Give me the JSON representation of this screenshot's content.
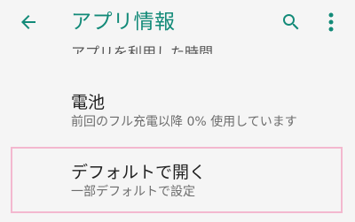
{
  "appbar": {
    "title": "アプリ情報",
    "accent_color": "#128a78",
    "icons": [
      "back-arrow-icon",
      "search-icon",
      "more-vert-icon"
    ]
  },
  "list": {
    "partial_item": "アプリを利用した時間",
    "items": [
      {
        "title": "電池",
        "subtitle": "前回のフル充電以降 0% 使用しています"
      },
      {
        "title": "デフォルトで開く",
        "subtitle": "一部デフォルトで設定"
      }
    ],
    "highlight_color": "#f3b8cf"
  }
}
